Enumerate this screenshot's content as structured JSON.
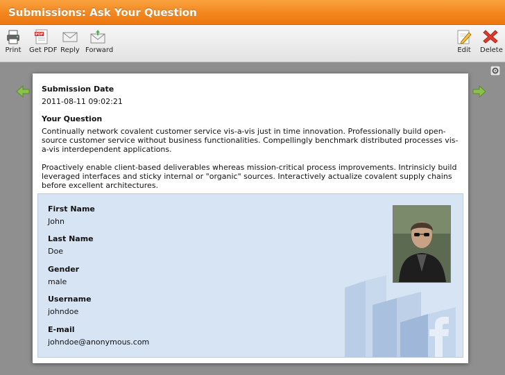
{
  "window": {
    "title": "Submissions: Ask Your Question"
  },
  "toolbar": {
    "print": "Print",
    "get_pdf": "Get PDF",
    "reply": "Reply",
    "forward": "Forward",
    "edit": "Edit",
    "delete": "Delete"
  },
  "submission": {
    "date_label": "Submission Date",
    "date_value": "2011-08-11 09:02:21",
    "question_label": "Your Question",
    "question_p1": "Continually network covalent customer service vis-a-vis just in time innovation. Professionally build open-source customer service without business functionalities. Compellingly benchmark distributed processes vis-a-vis interdependent applications.",
    "question_p2": "Proactively enable client-based deliverables whereas mission-critical process improvements. Intrinsicly build leveraged interfaces and sticky internal or \"organic\" sources. Interactively actualize covalent supply chains before excellent architectures."
  },
  "profile": {
    "first_name_label": "First Name",
    "first_name": "John",
    "last_name_label": "Last Name",
    "last_name": "Doe",
    "gender_label": "Gender",
    "gender": "male",
    "username_label": "Username",
    "username": "johndoe",
    "email_label": "E-mail",
    "email": "johndoe@anonymous.com"
  },
  "colors": {
    "titlebar": "#f3861e",
    "panel": "#d7e4f4",
    "arrow": "#8bc34a"
  },
  "icons": [
    "printer-icon",
    "pdf-icon",
    "envelope-icon",
    "forward-envelope-icon",
    "edit-icon",
    "delete-icon",
    "gear-icon",
    "left-arrow-icon",
    "right-arrow-icon",
    "facebook-logo-icon"
  ]
}
